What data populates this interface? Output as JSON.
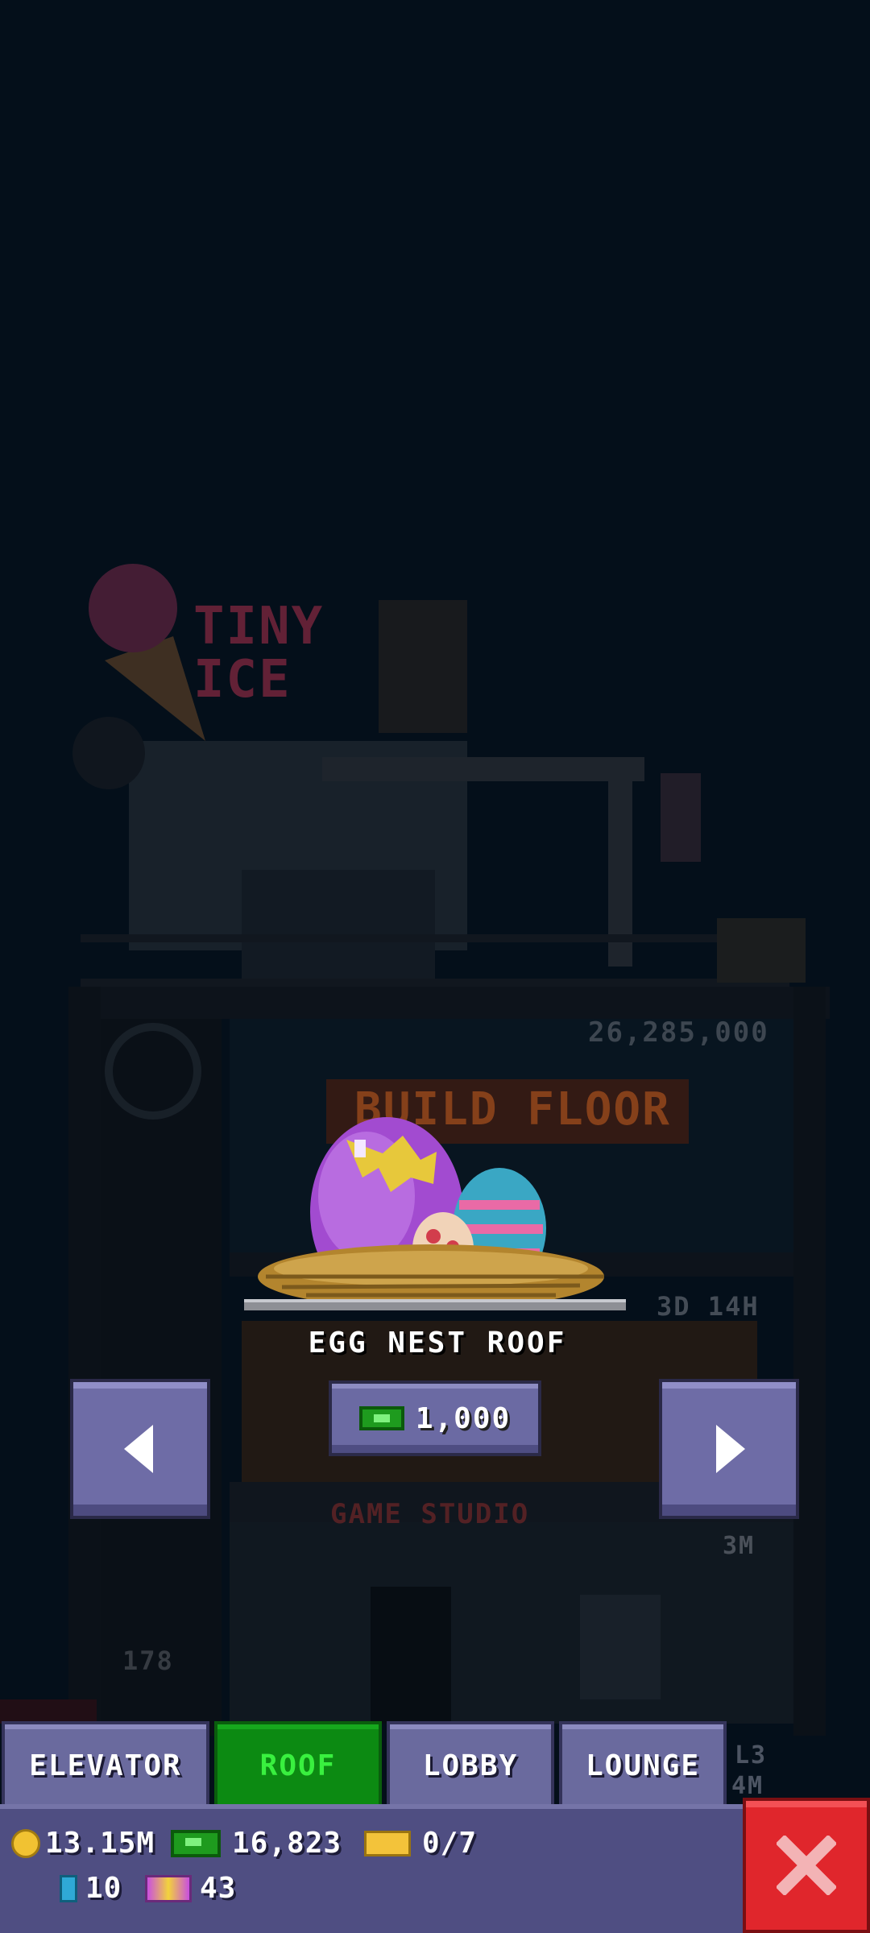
{
  "background": {
    "building_sign": "TINY ICE",
    "floor_cost": "26,285,000",
    "build_floor_label": "BUILD FLOOR",
    "timer": "3D 14H",
    "floor_name": "GAME STUDIO",
    "floor_badge": "3M",
    "floor_number": "178",
    "level_label_1": "L3",
    "level_label_2": "4M"
  },
  "preview": {
    "title": "EGG NEST ROOF",
    "price": "1,000",
    "prev_icon": "arrow-left-icon",
    "next_icon": "arrow-right-icon"
  },
  "tabs": [
    {
      "label": "ELEVATOR",
      "active": false
    },
    {
      "label": "ROOF",
      "active": true
    },
    {
      "label": "LOBBY",
      "active": false
    },
    {
      "label": "LOUNGE",
      "active": false
    }
  ],
  "stats": {
    "coins": "13.15M",
    "bux": "16,823",
    "tickets": "0/7",
    "keys": "10",
    "vip": "43"
  },
  "colors": {
    "accent_active_tab": "#0c8a12",
    "close_button": "#e0262c",
    "panel": "#4f4e82"
  }
}
